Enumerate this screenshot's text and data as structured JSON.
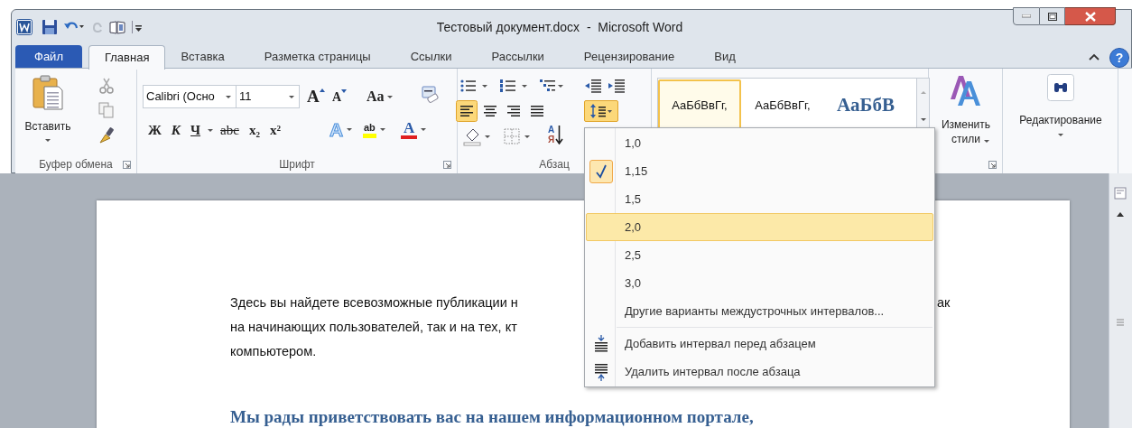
{
  "window": {
    "title": "Тестовый документ.docx  -  Microsoft Word"
  },
  "tabs": [
    {
      "label": "Файл",
      "kind": "file",
      "selected": false
    },
    {
      "label": "Главная",
      "kind": "tab",
      "selected": true
    },
    {
      "label": "Вставка",
      "kind": "tab",
      "selected": false
    },
    {
      "label": "Разметка страницы",
      "kind": "tab",
      "selected": false
    },
    {
      "label": "Ссылки",
      "kind": "tab",
      "selected": false
    },
    {
      "label": "Рассылки",
      "kind": "tab",
      "selected": false
    },
    {
      "label": "Рецензирование",
      "kind": "tab",
      "selected": false
    },
    {
      "label": "Вид",
      "kind": "tab",
      "selected": false
    }
  ],
  "clipboard": {
    "paste_label": "Вставить",
    "group_label": "Буфер обмена"
  },
  "help_button": "?",
  "font": {
    "font_name": "Calibri (Осно",
    "font_size": "11",
    "grow_button": "A",
    "shrink_button": "A",
    "case_button": "Aa",
    "effects_button": "A",
    "highlight_button": "ab",
    "color_button": "A",
    "format_buttons": [
      {
        "text": "Ж",
        "kind": "bold"
      },
      {
        "text": "К",
        "kind": "italic"
      },
      {
        "text": "Ч",
        "kind": "underline"
      },
      {
        "text": "abc",
        "kind": "strike"
      },
      {
        "text": "x₂",
        "kind": "plain"
      },
      {
        "text": "x²",
        "kind": "plain"
      }
    ],
    "group_label": "Шрифт"
  },
  "paragraph": {
    "line_spacing_active": true,
    "sort_letters": [
      "A",
      "Я"
    ],
    "group_label": "Абзац"
  },
  "styles": {
    "samples": [
      {
        "text": "АаБбВвГг,",
        "kind": "normal",
        "selected": true
      },
      {
        "text": "АаБбВвГг,",
        "kind": "normal",
        "selected": false
      },
      {
        "text": "АаБбВ",
        "kind": "heading",
        "selected": false
      }
    ]
  },
  "change_styles": {
    "label": "Изменить стили"
  },
  "editing": {
    "label": "Редактирование"
  },
  "document": {
    "lines": [
      {
        "left": "Здесь вы найдете всевозможные публикации н",
        "right": "ак"
      },
      {
        "left": "на начинающих пользователей, так и на тех, кт"
      },
      {
        "left": "компьютером."
      }
    ],
    "heading": "Мы рады приветствовать вас на нашем информационном портале,"
  },
  "line_spacing_menu": [
    {
      "label": "1,0",
      "kind": "value",
      "checked": false,
      "selected": false
    },
    {
      "label": "1,15",
      "kind": "value",
      "checked": true,
      "selected": false
    },
    {
      "label": "1,5",
      "kind": "value",
      "checked": false,
      "selected": false
    },
    {
      "label": "2,0",
      "kind": "value",
      "checked": false,
      "selected": true
    },
    {
      "label": "2,5",
      "kind": "value",
      "checked": false,
      "selected": false
    },
    {
      "label": "3,0",
      "kind": "value",
      "checked": false,
      "selected": false
    },
    {
      "label": "Другие варианты междустрочных интервалов...",
      "kind": "more",
      "checked": false,
      "selected": false
    },
    {
      "label": "Добавить интервал перед абзацем",
      "kind": "add_before",
      "checked": false,
      "selected": false
    },
    {
      "label": "Удалить интервал после абзаца",
      "kind": "remove_after",
      "checked": false,
      "selected": false
    }
  ]
}
